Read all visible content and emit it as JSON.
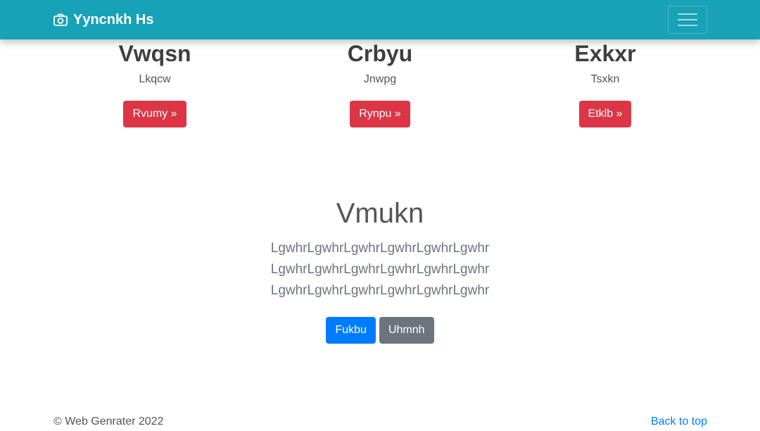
{
  "navbar": {
    "brand_icon": "camera-icon",
    "brand": "Yyncnkh Hs",
    "toggler_icon": "hamburger-menu-icon"
  },
  "features": [
    {
      "title": "Vwqsn",
      "text": "Lkqcw",
      "button": "Rvumy »"
    },
    {
      "title": "Crbyu",
      "text": "Jnwpg",
      "button": "Rynpu »"
    },
    {
      "title": "Exkxr",
      "text": "Tsxkn",
      "button": "Etklb »"
    }
  ],
  "hero": {
    "title": "Vmukn",
    "lead": [
      "LgwhrLgwhrLgwhrLgwhrLgwhrLgwhr",
      "LgwhrLgwhrLgwhrLgwhrLgwhrLgwhr",
      "LgwhrLgwhrLgwhrLgwhrLgwhrLgwhr"
    ],
    "primary_button": "Fukbu",
    "secondary_button": "Uhmnh"
  },
  "footer": {
    "copyright": "© Web Genrater 2022",
    "back_to_top": "Back to top"
  },
  "colors": {
    "navbar": "#17a2b8",
    "danger": "#dc3545",
    "primary": "#007bff",
    "secondary": "#6c757d"
  }
}
